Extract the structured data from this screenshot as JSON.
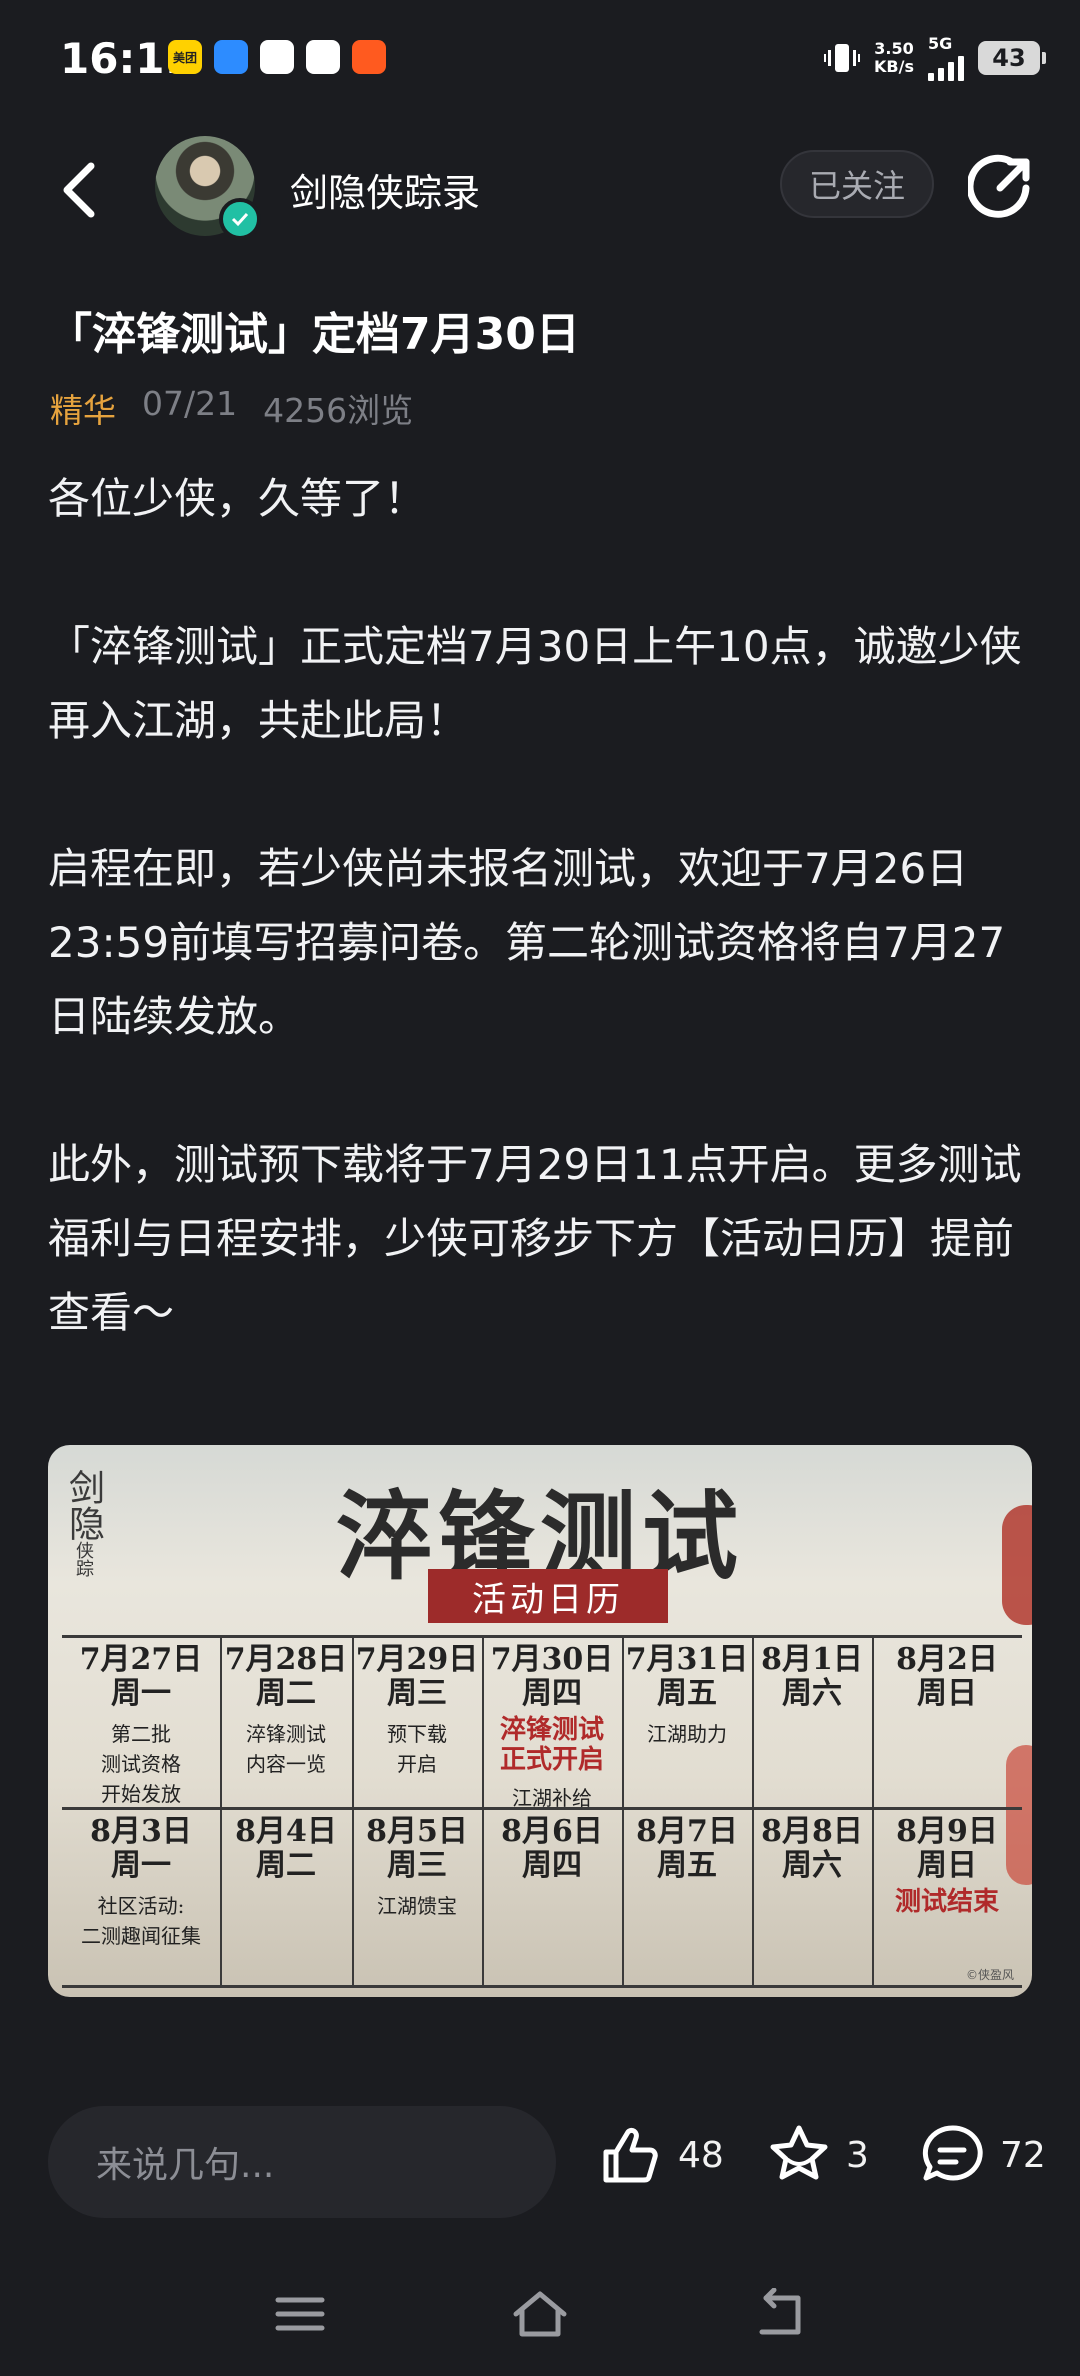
{
  "status_bar": {
    "time": "16:11",
    "net_speed_value": "3.50",
    "net_speed_unit": "KB/s",
    "network": "5G",
    "battery": "43",
    "app_icons": [
      {
        "name": "meituan-icon",
        "label": "美团",
        "color": "#ffd100"
      },
      {
        "name": "message-icon",
        "label": "",
        "color": "#2d8cff"
      },
      {
        "name": "bank-icon",
        "label": "",
        "color": "#ffffff"
      },
      {
        "name": "avatar-app-icon",
        "label": "",
        "color": "#ffffff"
      },
      {
        "name": "taobao-icon",
        "label": "",
        "color": "#ff5a1f"
      }
    ]
  },
  "header": {
    "author": "剑隐侠踪录",
    "follow_label": "已关注"
  },
  "article": {
    "title": "「淬锋测试」定档7月30日",
    "tag": "精华",
    "date": "07/21",
    "views": "4256浏览",
    "paragraphs": [
      "各位少侠，久等了！",
      "「淬锋测试」正式定档7月30日上午10点，诚邀少侠再入江湖，共赴此局！",
      "启程在即，若少侠尚未报名测试，欢迎于7月26日23:59前填写招募问卷。第二轮测试资格将自7月27日陆续发放。",
      "此外，测试预下载将于7月29日11点开启。更多测试福利与日程安排，少侠可移步下方【活动日历】提前查看～"
    ]
  },
  "poster": {
    "logo": "剑隐",
    "logo_small": "侠踪",
    "title": "淬锋测试",
    "subtitle": "活动日历",
    "copyright": "©侠盈风",
    "row1": [
      {
        "date": "7月27日",
        "weekday": "周一",
        "note": "第二批\n测试资格\n开始发放",
        "red": ""
      },
      {
        "date": "7月28日",
        "weekday": "周二",
        "note": "淬锋测试\n内容一览",
        "red": ""
      },
      {
        "date": "7月29日",
        "weekday": "周三",
        "note": "预下载\n开启",
        "red": ""
      },
      {
        "date": "7月30日",
        "weekday": "周四",
        "note": "江湖补给",
        "red": "淬锋测试\n正式开启"
      },
      {
        "date": "7月31日",
        "weekday": "周五",
        "note": "江湖助力",
        "red": ""
      },
      {
        "date": "8月1日",
        "weekday": "周六",
        "note": "",
        "red": ""
      },
      {
        "date": "8月2日",
        "weekday": "周日",
        "note": "",
        "red": ""
      }
    ],
    "row2": [
      {
        "date": "8月3日",
        "weekday": "周一",
        "note": "社区活动:\n二测趣闻征集",
        "red": ""
      },
      {
        "date": "8月4日",
        "weekday": "周二",
        "note": "",
        "red": ""
      },
      {
        "date": "8月5日",
        "weekday": "周三",
        "note": "江湖馈宝",
        "red": ""
      },
      {
        "date": "8月6日",
        "weekday": "周四",
        "note": "",
        "red": ""
      },
      {
        "date": "8月7日",
        "weekday": "周五",
        "note": "",
        "red": ""
      },
      {
        "date": "8月8日",
        "weekday": "周六",
        "note": "",
        "red": ""
      },
      {
        "date": "8月9日",
        "weekday": "周日",
        "note": "",
        "red": "测试结束"
      }
    ]
  },
  "actions": {
    "comment_placeholder": "来说几句...",
    "likes": "48",
    "favorites": "3",
    "comments": "72"
  }
}
